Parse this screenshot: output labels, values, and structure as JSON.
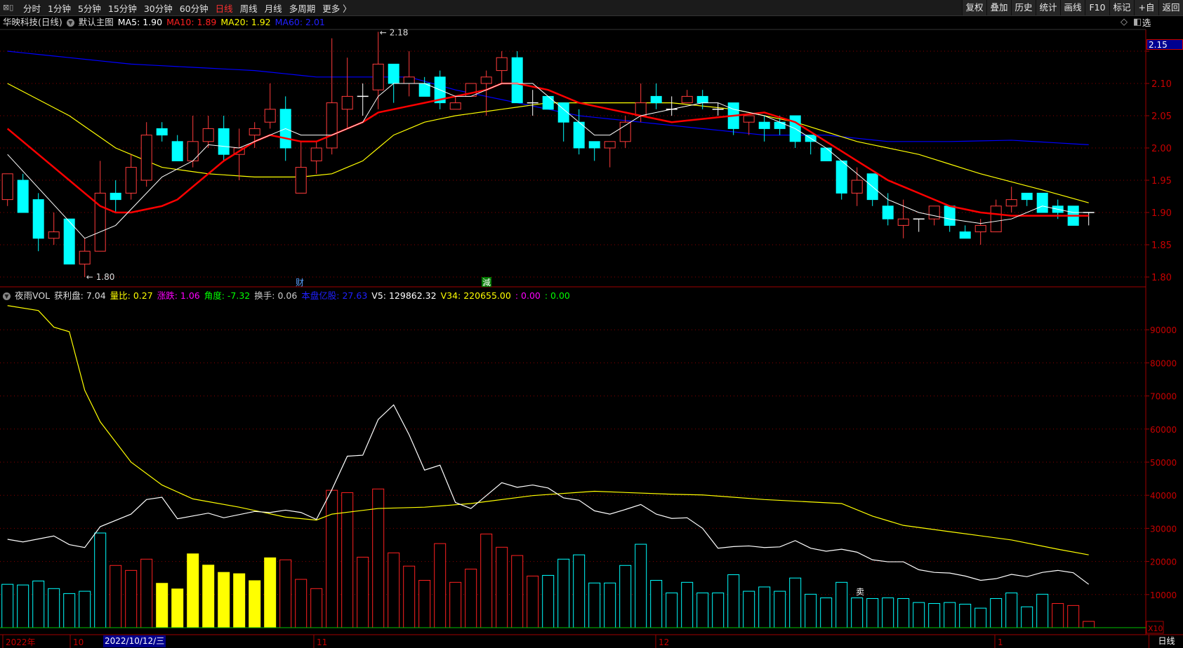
{
  "toolbar": {
    "periods": [
      "分时",
      "1分钟",
      "5分钟",
      "15分钟",
      "30分钟",
      "60分钟",
      "日线",
      "周线",
      "月线",
      "多周期",
      "更多 〉"
    ],
    "active_period": "日线",
    "buttons": [
      "复权",
      "叠加",
      "历史",
      "统计",
      "画线",
      "F10",
      "标记",
      "+自选",
      "返回"
    ]
  },
  "price_legend": {
    "title": "华映科技(日线)",
    "template": "默认主图",
    "ma5": "MA5: 1.90",
    "ma10": "MA10: 1.89",
    "ma20": "MA20: 1.92",
    "ma60": "MA60: 2.01"
  },
  "volume_legend": {
    "name": "夜雨VOL",
    "profit": "获利盘: 7.04",
    "vol_ratio": "量比: 0.27",
    "change": "涨跌: 1.06",
    "angle": "角度: -7.32",
    "turnover": "换手: 0.06",
    "float_shares": "本盘亿股: 27.63",
    "v5": "V5: 129862.32",
    "v34": "V34: 220655.00",
    "x1": ": 0.00",
    "x2": ": 0.00"
  },
  "colors": {
    "up": "#ff3b3b",
    "down": "#00ffff",
    "ma5": "#ffffff",
    "ma10": "#ff0000",
    "ma20": "#ffff00",
    "ma60": "#0000ff",
    "grid": "#8b0000",
    "axis_text": "#c80000",
    "v34": "#ffff00",
    "v5": "#ffffff"
  },
  "price_axis": {
    "current_box": "2.15",
    "ticks": [
      "2.15",
      "2.10",
      "2.05",
      "2.00",
      "1.95",
      "1.90",
      "1.85",
      "1.80"
    ]
  },
  "volume_axis": {
    "ticks": [
      "90000",
      "80000",
      "70000",
      "60000",
      "50000",
      "40000",
      "30000",
      "20000",
      "10000"
    ],
    "unit": "X10"
  },
  "date_axis": {
    "labels": [
      "2022年",
      "10",
      "11",
      "12",
      "1"
    ],
    "selected_date": "2022/10/12/三",
    "period": "日线"
  },
  "annotations": {
    "high_label": "2.18",
    "low_label": "1.80",
    "marker_cai": "财",
    "marker_jian": "減",
    "marker_sell": "卖"
  },
  "chart_data": {
    "type": "candlestick",
    "candles_ohlc": [
      [
        1.92,
        1.96,
        1.91,
        1.96
      ],
      [
        1.95,
        1.96,
        1.9,
        1.9
      ],
      [
        1.92,
        1.93,
        1.84,
        1.86
      ],
      [
        1.86,
        1.9,
        1.85,
        1.87
      ],
      [
        1.89,
        1.89,
        1.82,
        1.82
      ],
      [
        1.82,
        1.86,
        1.8,
        1.84
      ],
      [
        1.84,
        1.98,
        1.84,
        1.93
      ],
      [
        1.93,
        1.95,
        1.9,
        1.92
      ],
      [
        1.93,
        1.99,
        1.92,
        1.97
      ],
      [
        1.95,
        2.04,
        1.94,
        2.02
      ],
      [
        2.03,
        2.04,
        2.01,
        2.02
      ],
      [
        2.01,
        2.02,
        1.98,
        1.98
      ],
      [
        1.98,
        2.05,
        1.97,
        2.01
      ],
      [
        2.01,
        2.05,
        2.0,
        2.03
      ],
      [
        2.03,
        2.05,
        1.98,
        1.99
      ],
      [
        1.99,
        2.03,
        1.95,
        2.0
      ],
      [
        2.02,
        2.04,
        2.0,
        2.03
      ],
      [
        2.04,
        2.1,
        2.03,
        2.06
      ],
      [
        2.06,
        2.08,
        1.98,
        2.0
      ],
      [
        1.93,
        2.01,
        1.93,
        1.97
      ],
      [
        1.98,
        2.01,
        1.96,
        2.0
      ],
      [
        2.0,
        2.17,
        1.99,
        2.07
      ],
      [
        2.06,
        2.14,
        2.03,
        2.08
      ],
      [
        2.08,
        2.1,
        2.05,
        2.08
      ],
      [
        2.09,
        2.18,
        2.06,
        2.13
      ],
      [
        2.13,
        2.13,
        2.07,
        2.1
      ],
      [
        2.1,
        2.15,
        2.08,
        2.11
      ],
      [
        2.1,
        2.11,
        2.08,
        2.08
      ],
      [
        2.11,
        2.12,
        2.06,
        2.07
      ],
      [
        2.06,
        2.08,
        2.06,
        2.07
      ],
      [
        2.08,
        2.1,
        2.08,
        2.1
      ],
      [
        2.1,
        2.12,
        2.05,
        2.11
      ],
      [
        2.12,
        2.15,
        2.1,
        2.14
      ],
      [
        2.14,
        2.15,
        2.07,
        2.07
      ],
      [
        2.07,
        2.09,
        2.05,
        2.07
      ],
      [
        2.08,
        2.08,
        2.06,
        2.06
      ],
      [
        2.07,
        2.07,
        2.01,
        2.04
      ],
      [
        2.04,
        2.06,
        1.99,
        2.0
      ],
      [
        2.01,
        2.01,
        1.98,
        2.0
      ],
      [
        2.0,
        2.01,
        1.97,
        2.01
      ],
      [
        2.01,
        2.05,
        2.0,
        2.04
      ],
      [
        2.05,
        2.1,
        2.04,
        2.07
      ],
      [
        2.08,
        2.1,
        2.06,
        2.07
      ],
      [
        2.06,
        2.08,
        2.05,
        2.06
      ],
      [
        2.07,
        2.09,
        2.07,
        2.08
      ],
      [
        2.08,
        2.09,
        2.06,
        2.07
      ],
      [
        2.06,
        2.07,
        2.05,
        2.06
      ],
      [
        2.07,
        2.07,
        2.02,
        2.03
      ],
      [
        2.04,
        2.05,
        2.02,
        2.05
      ],
      [
        2.04,
        2.05,
        2.01,
        2.03
      ],
      [
        2.04,
        2.05,
        2.02,
        2.03
      ],
      [
        2.05,
        2.05,
        2.0,
        2.01
      ],
      [
        2.02,
        2.02,
        1.99,
        2.01
      ],
      [
        2.0,
        2.0,
        1.98,
        1.98
      ],
      [
        1.98,
        1.98,
        1.92,
        1.93
      ],
      [
        1.93,
        1.97,
        1.91,
        1.95
      ],
      [
        1.96,
        1.96,
        1.91,
        1.92
      ],
      [
        1.91,
        1.93,
        1.88,
        1.89
      ],
      [
        1.88,
        1.92,
        1.86,
        1.89
      ],
      [
        1.89,
        1.89,
        1.87,
        1.89
      ],
      [
        1.89,
        1.91,
        1.88,
        1.91
      ],
      [
        1.91,
        1.91,
        1.87,
        1.88
      ],
      [
        1.87,
        1.88,
        1.86,
        1.86
      ],
      [
        1.87,
        1.89,
        1.85,
        1.88
      ],
      [
        1.87,
        1.92,
        1.87,
        1.91
      ],
      [
        1.91,
        1.94,
        1.9,
        1.92
      ],
      [
        1.93,
        1.93,
        1.91,
        1.92
      ],
      [
        1.93,
        1.93,
        1.9,
        1.9
      ],
      [
        1.91,
        1.92,
        1.89,
        1.9
      ],
      [
        1.91,
        1.91,
        1.88,
        1.88
      ],
      [
        1.9,
        1.9,
        1.88,
        1.9
      ]
    ],
    "ma5": [
      [
        1,
        1.99
      ],
      [
        6,
        1.86
      ],
      [
        8,
        1.88
      ],
      [
        10,
        1.93
      ],
      [
        11,
        1.955
      ],
      [
        13,
        1.98
      ],
      [
        14,
        2.005
      ],
      [
        16,
        2.0
      ],
      [
        18,
        2.02
      ],
      [
        19,
        2.03
      ],
      [
        20,
        2.02
      ],
      [
        22,
        2.02
      ],
      [
        23,
        2.03
      ],
      [
        24,
        2.04
      ],
      [
        25,
        2.08
      ],
      [
        26,
        2.1
      ],
      [
        28,
        2.1
      ],
      [
        30,
        2.08
      ],
      [
        31,
        2.08
      ],
      [
        33,
        2.1
      ],
      [
        35,
        2.1
      ],
      [
        36,
        2.08
      ],
      [
        38,
        2.04
      ],
      [
        39,
        2.02
      ],
      [
        40,
        2.02
      ],
      [
        42,
        2.05
      ],
      [
        44,
        2.06
      ],
      [
        46,
        2.07
      ],
      [
        47,
        2.07
      ],
      [
        48,
        2.06
      ],
      [
        50,
        2.05
      ],
      [
        52,
        2.03
      ],
      [
        54,
        2.0
      ],
      [
        56,
        1.96
      ],
      [
        58,
        1.92
      ],
      [
        60,
        1.9
      ],
      [
        62,
        1.89
      ],
      [
        64,
        1.883
      ],
      [
        66,
        1.89
      ],
      [
        68,
        1.91
      ],
      [
        70,
        1.9
      ],
      [
        71,
        1.9
      ]
    ],
    "ma10": [
      [
        1,
        2.03
      ],
      [
        3,
        1.99
      ],
      [
        5,
        1.95
      ],
      [
        7,
        1.91
      ],
      [
        8,
        1.9
      ],
      [
        9,
        1.9
      ],
      [
        11,
        1.91
      ],
      [
        12,
        1.92
      ],
      [
        14,
        1.96
      ],
      [
        15,
        1.98
      ],
      [
        17,
        2.01
      ],
      [
        18,
        2.02
      ],
      [
        20,
        2.01
      ],
      [
        21,
        2.01
      ],
      [
        23,
        2.03
      ],
      [
        24,
        2.04
      ],
      [
        25,
        2.055
      ],
      [
        26,
        2.06
      ],
      [
        28,
        2.07
      ],
      [
        30,
        2.08
      ],
      [
        32,
        2.09
      ],
      [
        33,
        2.1
      ],
      [
        34,
        2.1
      ],
      [
        36,
        2.09
      ],
      [
        38,
        2.07
      ],
      [
        40,
        2.06
      ],
      [
        42,
        2.05
      ],
      [
        44,
        2.04
      ],
      [
        46,
        2.045
      ],
      [
        48,
        2.05
      ],
      [
        50,
        2.055
      ],
      [
        52,
        2.04
      ],
      [
        54,
        2.01
      ],
      [
        56,
        1.98
      ],
      [
        58,
        1.95
      ],
      [
        60,
        1.93
      ],
      [
        62,
        1.91
      ],
      [
        64,
        1.9
      ],
      [
        66,
        1.895
      ],
      [
        68,
        1.895
      ],
      [
        71,
        1.895
      ]
    ],
    "ma20": [
      [
        1,
        2.1
      ],
      [
        5,
        2.05
      ],
      [
        8,
        2.0
      ],
      [
        11,
        1.97
      ],
      [
        14,
        1.96
      ],
      [
        17,
        1.955
      ],
      [
        20,
        1.955
      ],
      [
        22,
        1.96
      ],
      [
        24,
        1.98
      ],
      [
        26,
        2.02
      ],
      [
        28,
        2.04
      ],
      [
        30,
        2.05
      ],
      [
        33,
        2.06
      ],
      [
        36,
        2.07
      ],
      [
        40,
        2.07
      ],
      [
        44,
        2.07
      ],
      [
        48,
        2.06
      ],
      [
        52,
        2.04
      ],
      [
        56,
        2.01
      ],
      [
        60,
        1.99
      ],
      [
        64,
        1.96
      ],
      [
        68,
        1.935
      ],
      [
        71,
        1.915
      ]
    ],
    "ma60": [
      [
        1,
        2.15
      ],
      [
        5,
        2.14
      ],
      [
        9,
        2.13
      ],
      [
        13,
        2.125
      ],
      [
        17,
        2.12
      ],
      [
        21,
        2.11
      ],
      [
        25,
        2.11
      ],
      [
        27,
        2.11
      ],
      [
        30,
        2.09
      ],
      [
        34,
        2.07
      ],
      [
        38,
        2.05
      ],
      [
        42,
        2.04
      ],
      [
        46,
        2.03
      ],
      [
        50,
        2.02
      ],
      [
        54,
        2.02
      ],
      [
        58,
        2.01
      ],
      [
        62,
        2.01
      ],
      [
        66,
        2.012
      ],
      [
        71,
        2.005
      ]
    ],
    "price_ylim": [
      1.78,
      2.18
    ],
    "volume": [
      13100,
      12900,
      14100,
      11800,
      10300,
      11000,
      28600,
      18800,
      17300,
      20700,
      13400,
      11700,
      22300,
      18900,
      16700,
      16300,
      14200,
      21100,
      20500,
      14600,
      11800,
      41500,
      40800,
      21300,
      41900,
      22600,
      18600,
      14300,
      25400,
      13700,
      17700,
      28300,
      24300,
      21800,
      15600,
      15800,
      20700,
      22000,
      13500,
      13500,
      18800,
      25200,
      14300,
      10500,
      13700,
      10500,
      10500,
      16000,
      11000,
      12300,
      11000,
      15000,
      10100,
      9000,
      13700,
      9000,
      8800,
      9000,
      8800,
      7600,
      7300,
      7600,
      7100,
      5900,
      8800,
      10500,
      6300,
      10100,
      7300,
      6700,
      1900
    ],
    "volume_colors": "cccccc rrryyyyyyyyrrrrrrrrrrrrrrrrrcccccccccccccccccccccccccccccccccrrrcy",
    "v5": [
      [
        1,
        26700
      ],
      [
        2,
        25900
      ],
      [
        4,
        27700
      ],
      [
        5,
        25100
      ],
      [
        6,
        24200
      ],
      [
        7,
        30500
      ],
      [
        9,
        34300
      ],
      [
        10,
        38700
      ],
      [
        11,
        39400
      ],
      [
        12,
        32900
      ],
      [
        14,
        34600
      ],
      [
        15,
        33200
      ],
      [
        17,
        35100
      ],
      [
        18,
        34800
      ],
      [
        19,
        35500
      ],
      [
        20,
        34800
      ],
      [
        21,
        32700
      ],
      [
        22,
        41700
      ],
      [
        23,
        51800
      ],
      [
        24,
        52100
      ],
      [
        25,
        62900
      ],
      [
        26,
        67300
      ],
      [
        27,
        58300
      ],
      [
        28,
        47600
      ],
      [
        29,
        49100
      ],
      [
        30,
        37800
      ],
      [
        31,
        36000
      ],
      [
        32,
        39900
      ],
      [
        33,
        43800
      ],
      [
        34,
        42400
      ],
      [
        35,
        43100
      ],
      [
        36,
        42200
      ],
      [
        37,
        39200
      ],
      [
        38,
        38500
      ],
      [
        39,
        35300
      ],
      [
        40,
        34300
      ],
      [
        41,
        35700
      ],
      [
        42,
        37200
      ],
      [
        43,
        34300
      ],
      [
        44,
        33000
      ],
      [
        45,
        33200
      ],
      [
        46,
        30000
      ],
      [
        47,
        24000
      ],
      [
        48,
        24500
      ],
      [
        49,
        24700
      ],
      [
        50,
        24200
      ],
      [
        51,
        24400
      ],
      [
        52,
        26300
      ],
      [
        53,
        24000
      ],
      [
        54,
        23100
      ],
      [
        55,
        23700
      ],
      [
        56,
        22800
      ],
      [
        57,
        20500
      ],
      [
        58,
        19900
      ],
      [
        59,
        19900
      ],
      [
        60,
        17500
      ],
      [
        61,
        16700
      ],
      [
        62,
        16500
      ],
      [
        63,
        15600
      ],
      [
        64,
        14300
      ],
      [
        65,
        14800
      ],
      [
        66,
        16100
      ],
      [
        67,
        15400
      ],
      [
        68,
        16700
      ],
      [
        69,
        17300
      ],
      [
        70,
        16600
      ],
      [
        71,
        13100
      ]
    ],
    "v34": [
      [
        1,
        97300
      ],
      [
        3,
        95800
      ],
      [
        4,
        90800
      ],
      [
        5,
        89400
      ],
      [
        6,
        71700
      ],
      [
        7,
        62200
      ],
      [
        9,
        50000
      ],
      [
        11,
        43100
      ],
      [
        13,
        38900
      ],
      [
        16,
        36400
      ],
      [
        19,
        33400
      ],
      [
        21,
        32500
      ],
      [
        22,
        34300
      ],
      [
        25,
        36000
      ],
      [
        28,
        36400
      ],
      [
        31,
        37500
      ],
      [
        35,
        39900
      ],
      [
        39,
        41200
      ],
      [
        44,
        40300
      ],
      [
        46,
        40100
      ],
      [
        50,
        38700
      ],
      [
        55,
        37500
      ],
      [
        57,
        33700
      ],
      [
        59,
        30900
      ],
      [
        62,
        29000
      ],
      [
        66,
        26500
      ],
      [
        69,
        23700
      ],
      [
        71,
        22000
      ]
    ],
    "volume_ylim": [
      0,
      100000
    ]
  }
}
